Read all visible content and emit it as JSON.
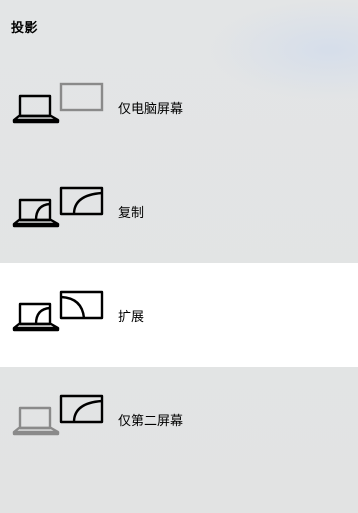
{
  "panel": {
    "title": "投影"
  },
  "options": [
    {
      "label": "仅电脑屏幕",
      "icon": "pc-screen-only-icon",
      "selected": false
    },
    {
      "label": "复制",
      "icon": "duplicate-icon",
      "selected": false
    },
    {
      "label": "扩展",
      "icon": "extend-icon",
      "selected": true
    },
    {
      "label": "仅第二屏幕",
      "icon": "second-screen-only-icon",
      "selected": false
    }
  ],
  "colors": {
    "background": "#e2e3e3",
    "selected_background": "#ffffff",
    "icon_active": "#000000",
    "icon_inactive": "#8a8a8a"
  }
}
